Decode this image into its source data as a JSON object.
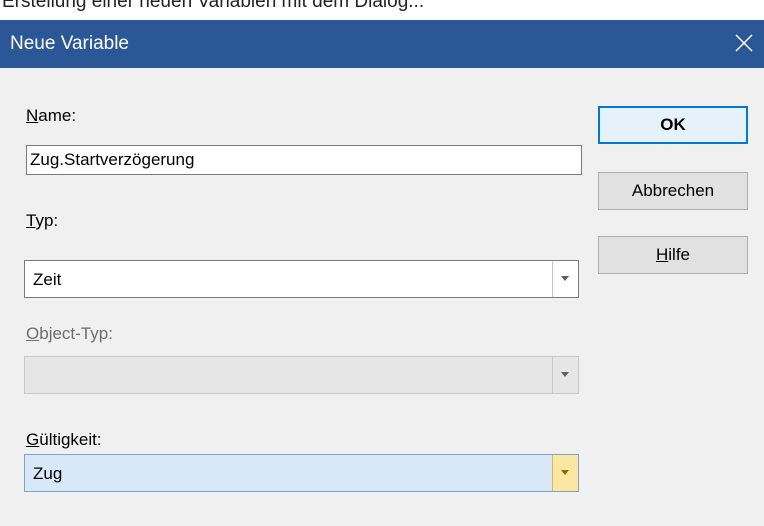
{
  "background_text": "Erstellung einer neuen Variablen mit dem Dialog...",
  "window": {
    "title": "Neue Variable",
    "titlebar_color": "#2b5797",
    "close_icon": "close-icon"
  },
  "form": {
    "name_label_mnemonic": "N",
    "name_label_rest": "ame:",
    "name_value": "Zug.Startverzögerung",
    "typ_label_mnemonic": "T",
    "typ_label_rest": "yp:",
    "typ_value": "Zeit",
    "object_typ_label_mnemonic": "O",
    "object_typ_label_rest": "bject-Typ:",
    "object_typ_value": "",
    "gueltigkeit_label_mnemonic": "G",
    "gueltigkeit_label_rest": "ültigkeit:",
    "gueltigkeit_value": "Zug"
  },
  "buttons": {
    "ok": "OK",
    "abbrechen": "Abbrechen",
    "hilfe_mnemonic": "H",
    "hilfe_rest": "ilfe"
  },
  "colors": {
    "accent": "#0078d7",
    "selected_field": "#d9e8f8",
    "dropdown_highlight": "#fbe7a1"
  }
}
